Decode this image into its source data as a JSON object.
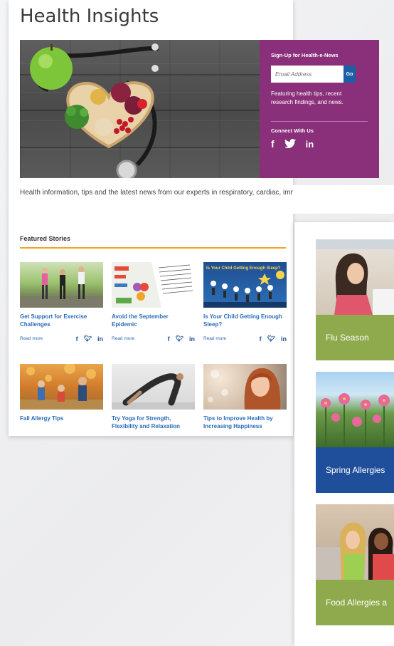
{
  "page": {
    "title": "Health Insights"
  },
  "signup": {
    "heading": "Sign-Up for Health-e-News",
    "email_placeholder": "Email Address",
    "go_label": "Go",
    "tagline": "Featuring health tips, recent research findings, and news.",
    "connect_heading": "Connect With Us"
  },
  "intro": "Health information, tips and the latest news from our experts in respiratory, cardiac, immune and related conditions.",
  "featured": {
    "heading": "Featured Stories",
    "stories": [
      {
        "title": "Get Support for Exercise Challenges",
        "read_more": "Read more"
      },
      {
        "title": "Avoid the September Epidemic",
        "read_more": "Read more"
      },
      {
        "title": "Is Your Child Getting Enough Sleep?",
        "read_more": "Read more",
        "thumb_caption": "Is Your Child Getting Enough Sleep?"
      },
      {
        "title": "Fall Allergy Tips"
      },
      {
        "title": "Try Yoga for Strength, Flexibility and Relaxation"
      },
      {
        "title": "Tips to Improve Health by Increasing Happiness"
      }
    ]
  },
  "topics": [
    {
      "label": "Flu Season",
      "color": "#8faa4c"
    },
    {
      "label": "Spring Allergies",
      "color": "#1f4f9a"
    },
    {
      "label": "Food Allergies a",
      "color": "#8faa4c"
    }
  ],
  "colors": {
    "signup_bg": "#8a2f7a",
    "accent": "#f1a425",
    "link": "#2a6bb8"
  }
}
